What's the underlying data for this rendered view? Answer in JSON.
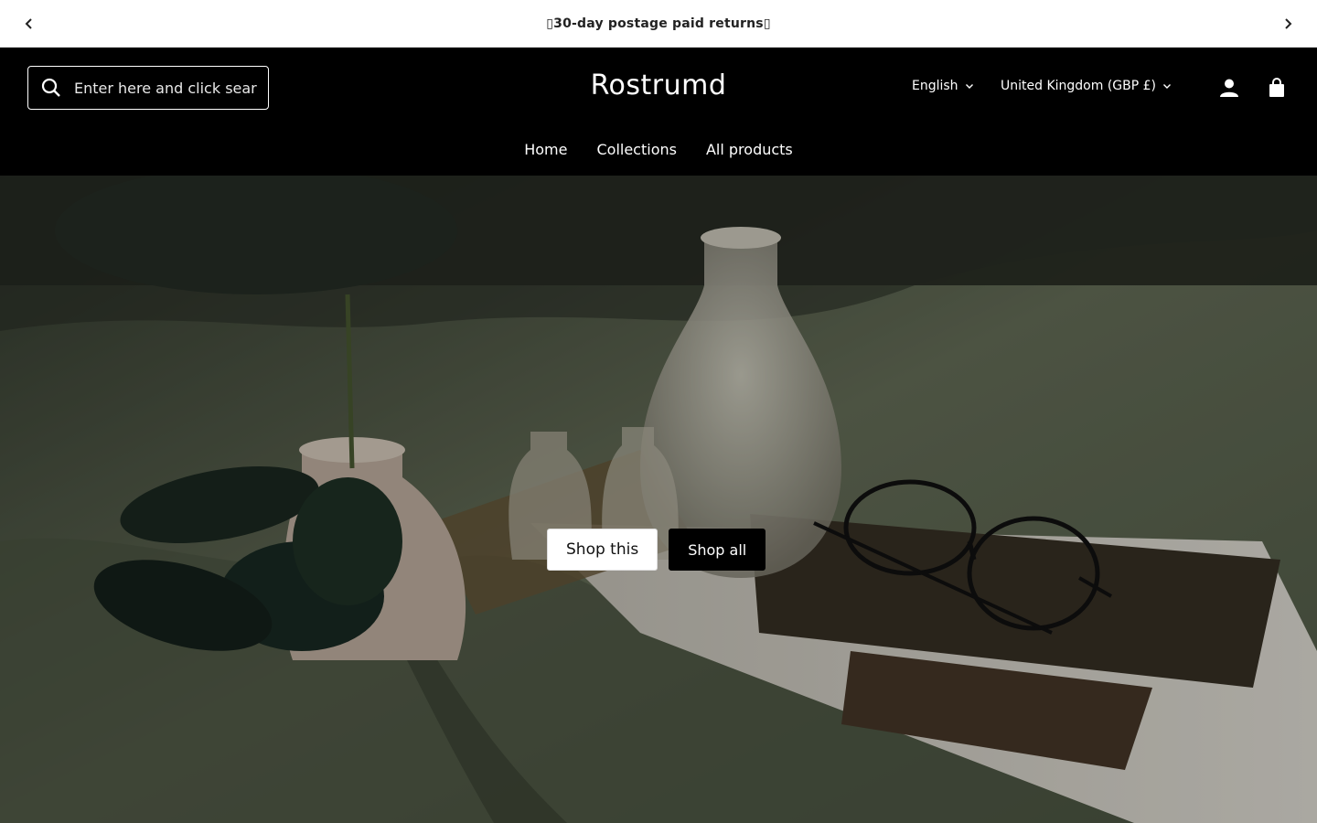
{
  "announcement": {
    "text": "30-day postage paid returns",
    "prev_icon": "chevron-left-icon",
    "next_icon": "chevron-right-icon"
  },
  "header": {
    "search_placeholder": "Enter here and click search",
    "search_icon": "search-icon",
    "logo": "Rostrumd",
    "language": "English",
    "country": "United Kingdom (GBP £)",
    "account_icon": "account-icon",
    "cart_icon": "shopping-bag-icon"
  },
  "nav": {
    "items": [
      "Home",
      "Collections",
      "All products"
    ]
  },
  "hero": {
    "primary_button": "Shop this",
    "secondary_button": "Shop all"
  },
  "colors": {
    "header_bg": "#000000",
    "announce_bg": "#ffffff",
    "accent": "#000000"
  }
}
